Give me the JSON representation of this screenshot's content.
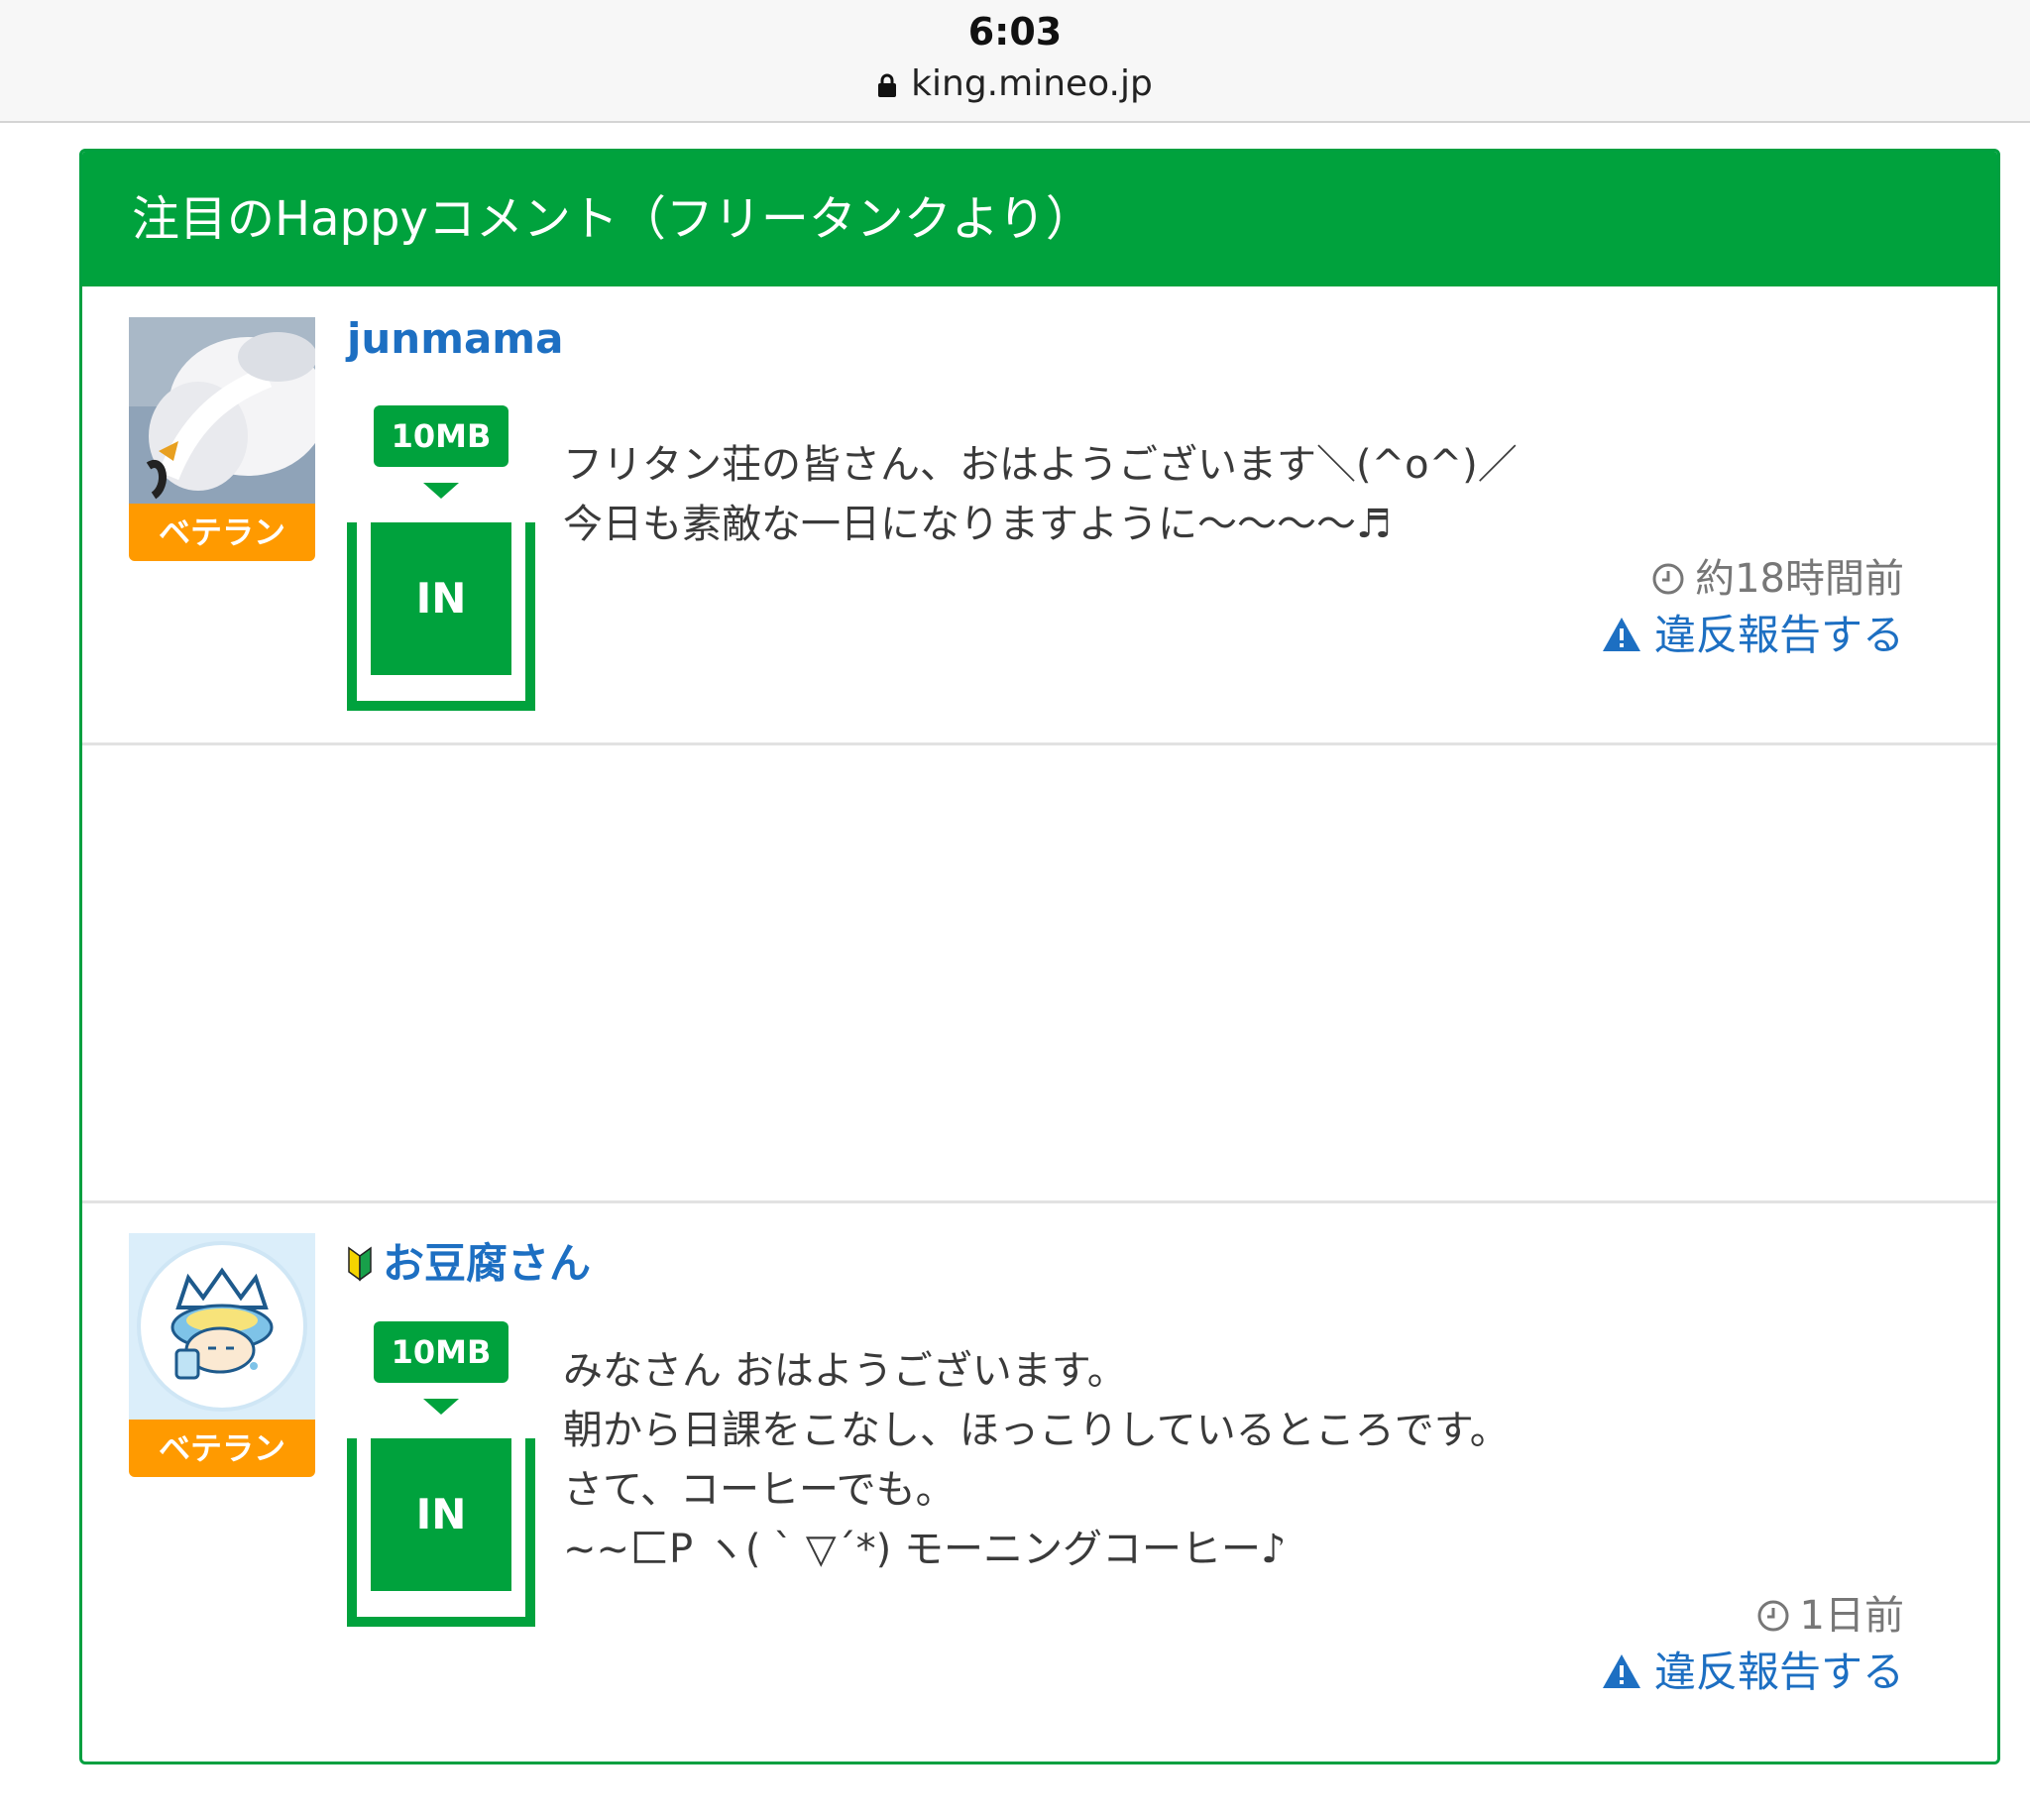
{
  "browser": {
    "time": "6:03",
    "url": "king.mineo.jp"
  },
  "panel": {
    "title": "注目のHappyコメント（フリータンクより）",
    "accent_color": "#00a23d"
  },
  "comments": [
    {
      "username": "junmama",
      "avatar": "swan-photo-icon",
      "rank": "ベテラン",
      "mb": "10MB",
      "direction": "IN",
      "text": "フリタン荘の皆さん、おはようございます＼(^o^)／\n今日も素敵な一日になりますように〜〜〜〜♬",
      "time": "約18時間前",
      "report": "違反報告する"
    },
    {
      "username": "お豆腐さん",
      "avatar": "onew-character-icon",
      "rank": "ベテラン",
      "mb": "10MB",
      "direction": "IN",
      "text": "みなさん おはようございます。\n朝から日課をこなし、ほっこりしているところです。\nさて、コーヒーでも。\n~~匚P ヽ( ` ▽´*) モーニングコーヒー♪",
      "time": "1日前",
      "report": "違反報告する"
    }
  ]
}
